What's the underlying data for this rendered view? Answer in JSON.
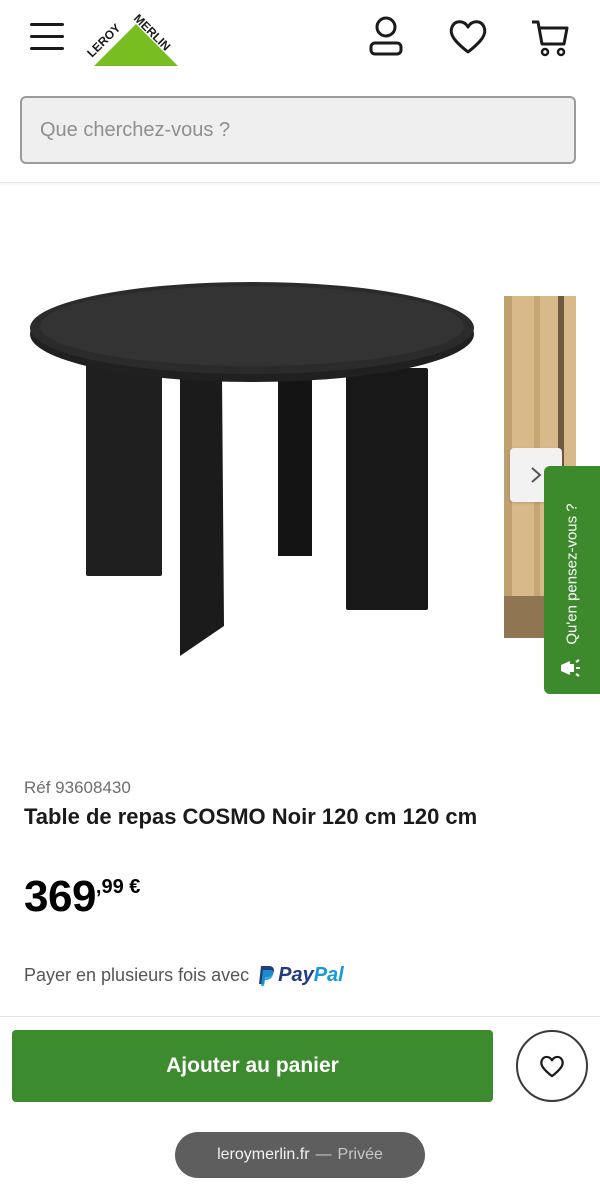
{
  "header": {
    "brand": "LEROY MERLIN",
    "brand_left": "LEROY",
    "brand_right": "MERLIN",
    "icons": [
      "menu-icon",
      "account-icon",
      "heart-icon",
      "cart-icon"
    ]
  },
  "search": {
    "placeholder": "Que cherchez-vous ?"
  },
  "feedback": {
    "label": "Qu'en pensez-vous ?"
  },
  "product": {
    "ref": "Réf 93608430",
    "title": "Table de repas COSMO Noir 120 cm 120 cm",
    "price_int": "369",
    "price_dec": ",99 €",
    "payment_text": "Payer en plusieurs fois avec",
    "payment_brand_pay": "Pay",
    "payment_brand_pal": "Pal"
  },
  "actions": {
    "add_to_cart": "Ajouter au panier"
  },
  "browser": {
    "domain": "leroymerlin.fr",
    "separator": "—",
    "mode": "Privée"
  },
  "colors": {
    "brand_green": "#3d8b2f",
    "paypal_dark": "#253b80",
    "paypal_light": "#179bd7"
  }
}
